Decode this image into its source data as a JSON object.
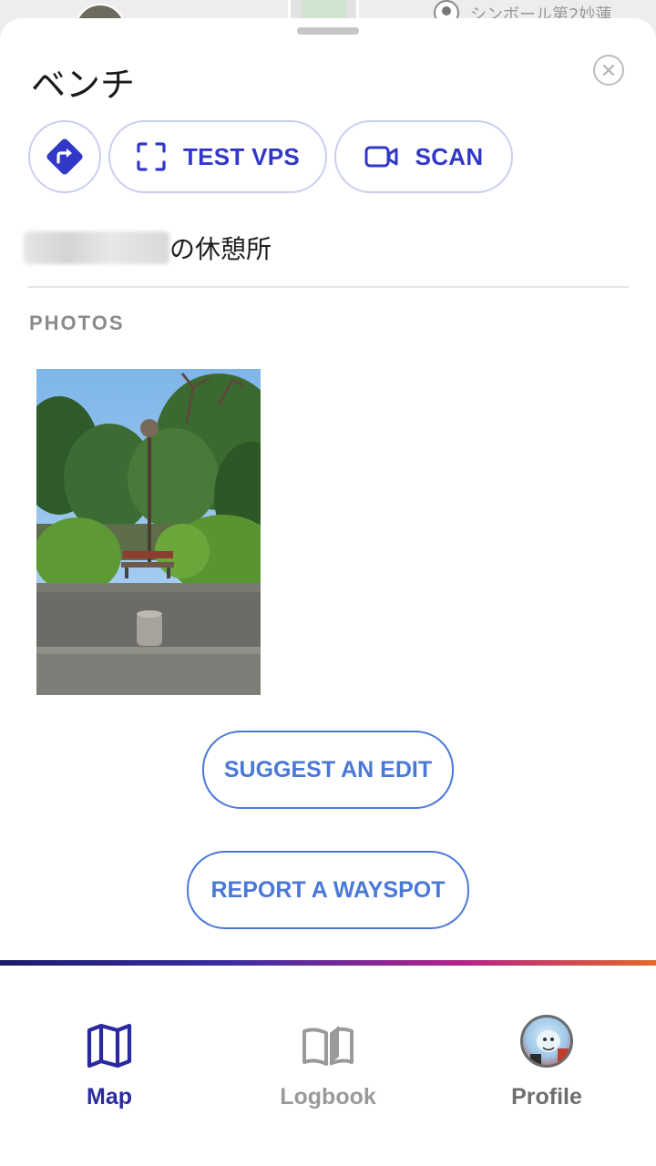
{
  "map_peek": {
    "label": "シンボール第2妙蓮"
  },
  "sheet": {
    "title": "ベンチ",
    "actions": {
      "test_vps_label": "TEST VPS",
      "scan_label": "SCAN"
    },
    "description_suffix": "の休憩所",
    "photos_label": "PHOTOS",
    "suggest_edit_label": "SUGGEST AN EDIT",
    "report_label": "REPORT A WAYSPOT"
  },
  "nav": {
    "map_label": "Map",
    "logbook_label": "Logbook",
    "profile_label": "Profile"
  },
  "colors": {
    "accent": "#3138c8",
    "link_blue": "#4a78d8",
    "nav_active": "#2a2a9e",
    "nav_inactive": "#9a9a9a"
  },
  "icons": {
    "directions": "directions-icon",
    "vps": "scan-frame-icon",
    "scan": "video-camera-icon",
    "close": "close-icon",
    "map": "map-icon",
    "logbook": "book-icon",
    "profile": "avatar"
  }
}
